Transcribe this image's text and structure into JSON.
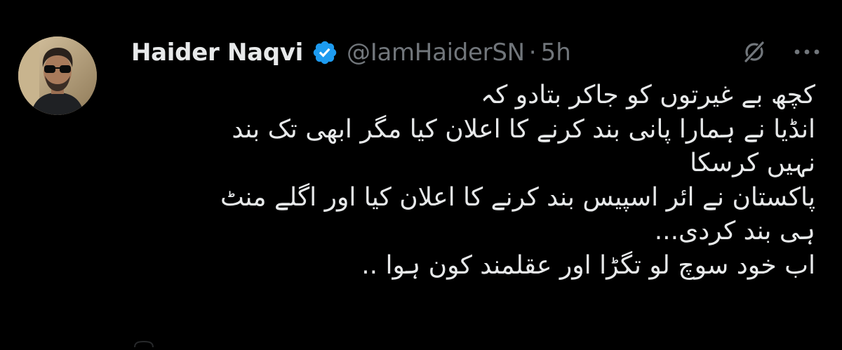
{
  "tweet": {
    "display_name": "Haider Naqvi",
    "verified_icon": "verified-badge-icon",
    "handle": "@IamHaiderSN",
    "separator": "·",
    "time": "5h",
    "lines": [
      "کچھ بے غیرتوں کو جاکر بتادو کہ",
      "انڈیا نے ہمارا پانی بند کرنے کا اعلان کیا مگر ابھی تک بند",
      "نہیں کرسکا",
      "پاکستان نے ائر اسپیس بند کرنے کا اعلان کیا اور اگلے منٹ",
      "ہی بند کردی...",
      "اب خود سوچ لو تگڑا اور عقلمند کون ہوا .."
    ]
  },
  "icons": {
    "avatar": "avatar",
    "grok": "grok-icon",
    "more": "more-icon"
  },
  "colors": {
    "background": "#000000",
    "primary_text": "#e7e9ea",
    "secondary_text": "#71767b",
    "verified_blue": "#1d9bf0"
  }
}
